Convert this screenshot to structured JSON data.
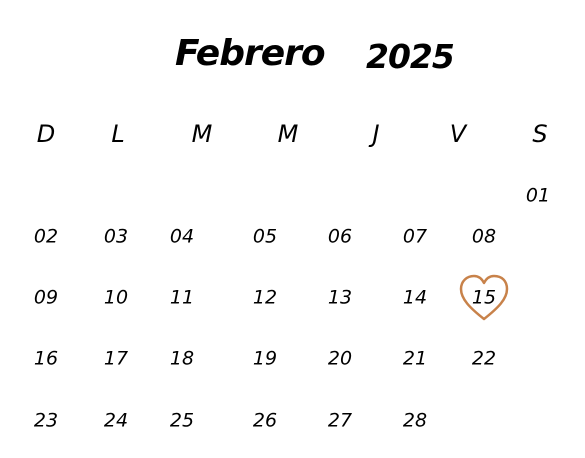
{
  "calendar": {
    "month": "Febrero",
    "year": "2025",
    "weekdays": [
      "D",
      "L",
      "M",
      "M",
      "J",
      "V",
      "S"
    ],
    "days": [
      {
        "label": "01",
        "weekday": 6,
        "week": 0
      },
      {
        "label": "02",
        "weekday": 0,
        "week": 1
      },
      {
        "label": "03",
        "weekday": 1,
        "week": 1
      },
      {
        "label": "04",
        "weekday": 2,
        "week": 1
      },
      {
        "label": "05",
        "weekday": 3,
        "week": 1
      },
      {
        "label": "06",
        "weekday": 4,
        "week": 1
      },
      {
        "label": "07",
        "weekday": 5,
        "week": 1
      },
      {
        "label": "08",
        "weekday": 6,
        "week": 1
      },
      {
        "label": "09",
        "weekday": 0,
        "week": 2
      },
      {
        "label": "10",
        "weekday": 1,
        "week": 2
      },
      {
        "label": "11",
        "weekday": 2,
        "week": 2
      },
      {
        "label": "12",
        "weekday": 3,
        "week": 2
      },
      {
        "label": "13",
        "weekday": 4,
        "week": 2
      },
      {
        "label": "14",
        "weekday": 5,
        "week": 2
      },
      {
        "label": "15",
        "weekday": 6,
        "week": 2
      },
      {
        "label": "16",
        "weekday": 0,
        "week": 3
      },
      {
        "label": "17",
        "weekday": 1,
        "week": 3
      },
      {
        "label": "18",
        "weekday": 2,
        "week": 3
      },
      {
        "label": "19",
        "weekday": 3,
        "week": 3
      },
      {
        "label": "20",
        "weekday": 4,
        "week": 3
      },
      {
        "label": "21",
        "weekday": 5,
        "week": 3
      },
      {
        "label": "22",
        "weekday": 6,
        "week": 3
      },
      {
        "label": "23",
        "weekday": 0,
        "week": 4
      },
      {
        "label": "24",
        "weekday": 1,
        "week": 4
      },
      {
        "label": "25",
        "weekday": 2,
        "week": 4
      },
      {
        "label": "26",
        "weekday": 3,
        "week": 4
      },
      {
        "label": "27",
        "weekday": 4,
        "week": 4
      },
      {
        "label": "28",
        "weekday": 5,
        "week": 4
      }
    ],
    "highlight": {
      "label": "15",
      "icon": "heart-icon",
      "color": "#c8824a"
    }
  }
}
